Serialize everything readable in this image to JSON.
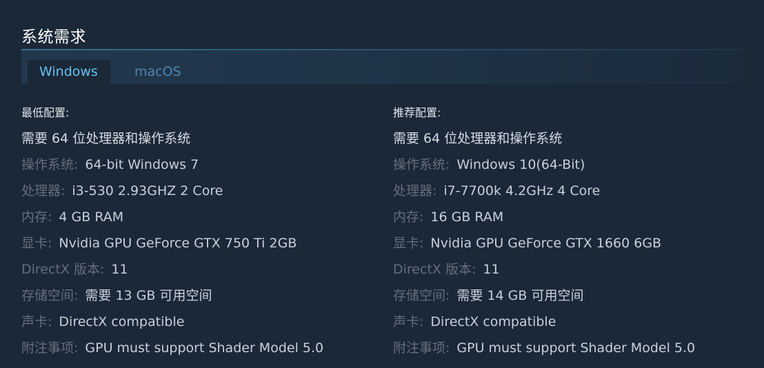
{
  "section": {
    "title": "系统需求"
  },
  "tabs": [
    {
      "label": "Windows"
    },
    {
      "label": "macOS"
    }
  ],
  "minimum": {
    "heading": "最低配置:",
    "note": "需要 64 位处理器和操作系统",
    "rows": [
      {
        "label": "操作系统:",
        "value": "64-bit Windows 7"
      },
      {
        "label": "处理器:",
        "value": "i3-530 2.93GHZ 2 Core"
      },
      {
        "label": "内存:",
        "value": "4 GB RAM"
      },
      {
        "label": "显卡:",
        "value": "Nvidia GPU GeForce GTX 750 Ti 2GB"
      },
      {
        "label": "DirectX 版本:",
        "value": "11"
      },
      {
        "label": "存储空间:",
        "value": "需要 13 GB 可用空间"
      },
      {
        "label": "声卡:",
        "value": "DirectX compatible"
      },
      {
        "label": "附注事项:",
        "value": "GPU must support Shader Model 5.0"
      }
    ]
  },
  "recommended": {
    "heading": "推荐配置:",
    "note": "需要 64 位处理器和操作系统",
    "rows": [
      {
        "label": "操作系统:",
        "value": "Windows 10(64-Bit)"
      },
      {
        "label": "处理器:",
        "value": "i7-7700k 4.2GHz 4 Core"
      },
      {
        "label": "内存:",
        "value": "16 GB RAM"
      },
      {
        "label": "显卡:",
        "value": "Nvidia GPU GeForce GTX 1660 6GB"
      },
      {
        "label": "DirectX 版本:",
        "value": "11"
      },
      {
        "label": "存储空间:",
        "value": "需要 14 GB 可用空间"
      },
      {
        "label": "声卡:",
        "value": "DirectX compatible"
      },
      {
        "label": "附注事项:",
        "value": "GPU must support Shader Model 5.0"
      }
    ]
  },
  "colors": {
    "background": "#1b2838",
    "active_tab_text": "#67c1f5",
    "inactive_tab_text": "#4f86ad",
    "label_text": "#646f7a",
    "value_text": "#c7d1da"
  }
}
